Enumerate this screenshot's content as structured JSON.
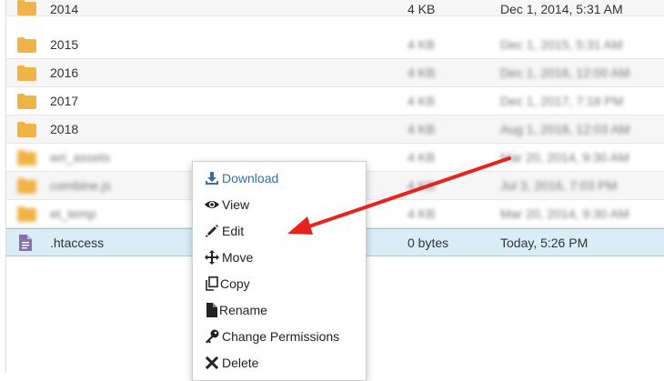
{
  "files": [
    {
      "name": "2014",
      "size": "4 KB",
      "date": "Dec 1, 2014, 5:31 AM",
      "type": "folder"
    },
    {
      "name": "2015",
      "size": "4 KB",
      "date": "Dec 1, 2015, 5:31 AM",
      "type": "folder"
    },
    {
      "name": "2016",
      "size": "4 KB",
      "date": "Dec 1, 2016, 12:00 AM",
      "type": "folder"
    },
    {
      "name": "2017",
      "size": "4 KB",
      "date": "Dec 1, 2017, 7:18 PM",
      "type": "folder"
    },
    {
      "name": "2018",
      "size": "4 KB",
      "date": "Aug 1, 2018, 12:03 AM",
      "type": "folder"
    },
    {
      "name": "wri_assets",
      "size": "4 KB",
      "date": "Mar 20, 2014, 9:30 AM",
      "type": "folder"
    },
    {
      "name": "combine.js",
      "size": "4 KB",
      "date": "Jul 3, 2016, 7:03 PM",
      "type": "folder"
    },
    {
      "name": "et_temp",
      "size": "4 KB",
      "date": "Mar 20, 2014, 9:30 AM",
      "type": "folder"
    },
    {
      "name": ".htaccess",
      "size": "0 bytes",
      "date": "Today, 5:26 PM",
      "type": "file"
    }
  ],
  "context_menu": {
    "items": [
      {
        "label": "Download",
        "icon": "download-icon"
      },
      {
        "label": "View",
        "icon": "eye-icon"
      },
      {
        "label": "Edit",
        "icon": "pencil-icon"
      },
      {
        "label": "Move",
        "icon": "move-icon"
      },
      {
        "label": "Copy",
        "icon": "copy-icon"
      },
      {
        "label": "Rename",
        "icon": "file-icon"
      },
      {
        "label": "Change Permissions",
        "icon": "key-icon"
      },
      {
        "label": "Delete",
        "icon": "x-icon"
      }
    ]
  },
  "colors": {
    "folder": "#f0b345",
    "file_icon": "#8a6fb0",
    "selected_row": "#d9edf7",
    "menu_highlight": "#3a6ea5",
    "annotation_arrow": "#e8231d"
  }
}
